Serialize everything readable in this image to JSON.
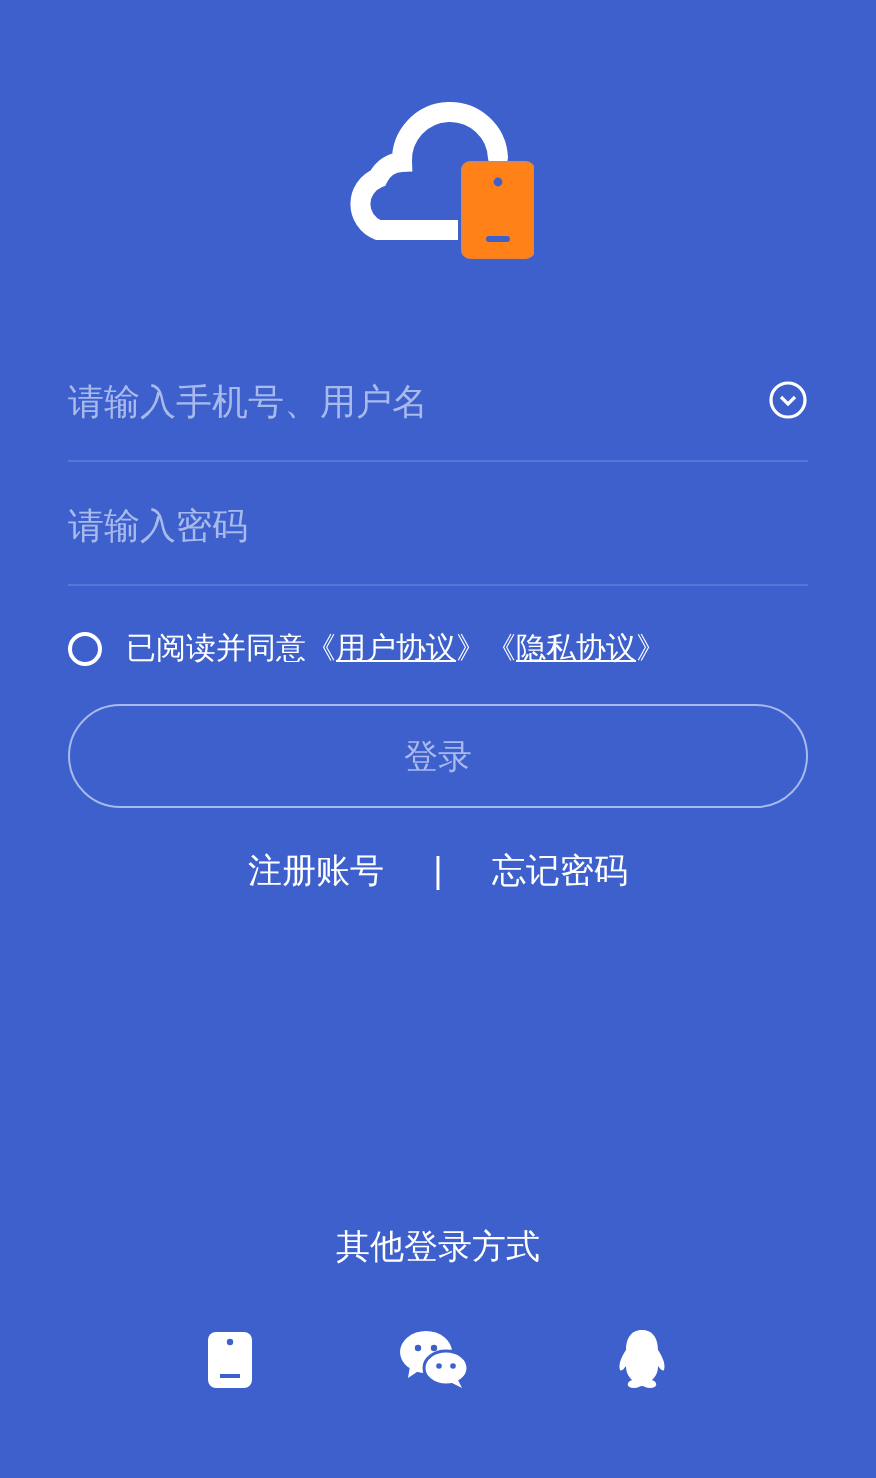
{
  "fields": [
    {
      "placeholder": "请输入手机号、用户名",
      "dropdown": true
    },
    {
      "placeholder": "请输入密码",
      "dropdown": false
    }
  ],
  "agreement": {
    "checked": false,
    "text": "已阅读并同意",
    "links": [
      {
        "open": "《",
        "label": "用户协议",
        "close": "》"
      },
      {
        "open": "《",
        "label": "隐私协议",
        "close": "》"
      }
    ]
  },
  "login_button": {
    "label": "登录",
    "disabled": true
  },
  "links": [
    "注册账号",
    "忘记密码"
  ],
  "separator": "|",
  "other_login": {
    "title": "其他登录方式",
    "methods": [
      {
        "kind": "phone"
      },
      {
        "kind": "wechat"
      },
      {
        "kind": "qq"
      }
    ]
  }
}
